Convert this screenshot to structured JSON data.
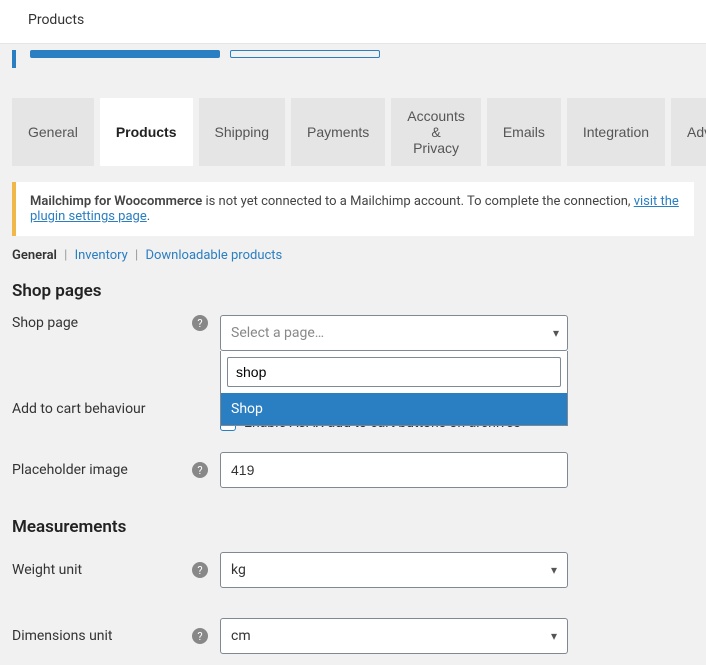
{
  "topbar": {
    "title": "Products"
  },
  "tabs": {
    "items": [
      {
        "label": "General"
      },
      {
        "label": "Products"
      },
      {
        "label": "Shipping"
      },
      {
        "label": "Payments"
      },
      {
        "label": "Accounts & Privacy"
      },
      {
        "label": "Emails"
      },
      {
        "label": "Integration"
      },
      {
        "label": "Advanced"
      }
    ],
    "active_index": 1
  },
  "notice": {
    "strong": "Mailchimp for Woocommerce",
    "text": " is not yet connected to a Mailchimp account. To complete the connection, ",
    "link": "visit the plugin settings page",
    "tail": "."
  },
  "subtabs": {
    "items": [
      {
        "label": "General"
      },
      {
        "label": "Inventory"
      },
      {
        "label": "Downloadable products"
      }
    ],
    "active_index": 0
  },
  "sections": {
    "shop_pages_heading": "Shop pages",
    "shop_page": {
      "label": "Shop page",
      "placeholder": "Select a page…",
      "search_value": "shop",
      "option": "Shop"
    },
    "add_to_cart": {
      "label": "Add to cart behaviour",
      "checkbox_label": "Enable AJAX add to cart buttons on archives",
      "checked": true
    },
    "placeholder_image": {
      "label": "Placeholder image",
      "value": "419"
    },
    "measurements_heading": "Measurements",
    "weight_unit": {
      "label": "Weight unit",
      "value": "kg"
    },
    "dimensions_unit": {
      "label": "Dimensions unit",
      "value": "cm"
    }
  }
}
